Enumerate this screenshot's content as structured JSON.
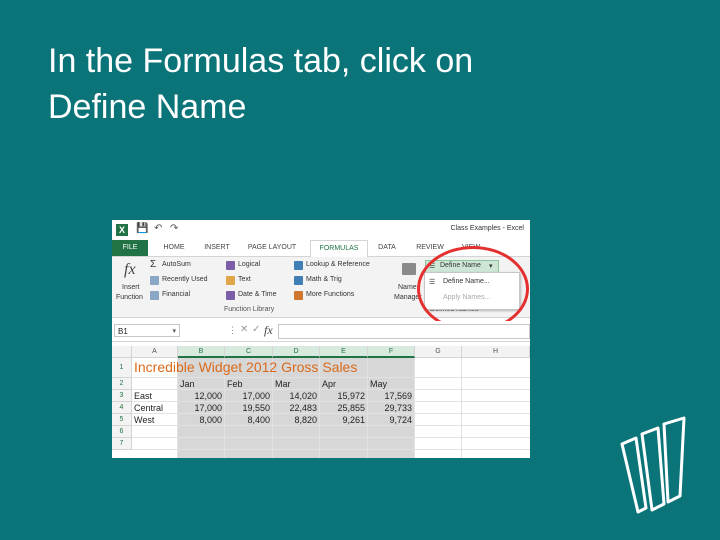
{
  "slide": {
    "title_line1": "In the Formulas tab, click on",
    "title_line2": "Define Name"
  },
  "window": {
    "title": "Class Examples - Excel",
    "app_icon": "X",
    "quick_access": [
      "save-icon",
      "undo-icon",
      "redo-icon"
    ]
  },
  "tabs": [
    "FILE",
    "HOME",
    "INSERT",
    "PAGE LAYOUT",
    "FORMULAS",
    "DATA",
    "REVIEW",
    "VIEW"
  ],
  "active_tab": "FORMULAS",
  "ribbon": {
    "insert_function": {
      "icon": "fx",
      "line1": "Insert",
      "line2": "Function"
    },
    "function_library": {
      "autosum": "AutoSum",
      "recently_used": "Recently Used",
      "financial": "Financial",
      "logical": "Logical",
      "text": "Text",
      "date_time": "Date & Time",
      "lookup": "Lookup & Reference",
      "math": "Math & Trig",
      "more": "More Functions",
      "label": "Function Library"
    },
    "name_manager": {
      "line1": "Name",
      "line2": "Manager"
    },
    "defined_names": {
      "define_name_button": "Define Name",
      "menu_items": [
        "Define Name...",
        "Apply Names..."
      ],
      "label": "Defined Names"
    }
  },
  "formula_bar": {
    "name_box": "B1",
    "fx_icon": "fx"
  },
  "sheet": {
    "columns": [
      "A",
      "B",
      "C",
      "D",
      "E",
      "F",
      "G",
      "H"
    ],
    "rows": [
      "1",
      "2",
      "3",
      "4",
      "5",
      "6",
      "7"
    ],
    "title_cell": "Incredible Widget 2012 Gross Sales",
    "months": [
      "Jan",
      "Feb",
      "Mar",
      "Apr",
      "May"
    ],
    "data": [
      {
        "region": "East",
        "values": [
          "12,000",
          "17,000",
          "14,020",
          "15,972",
          "17,569"
        ]
      },
      {
        "region": "Central",
        "values": [
          "17,000",
          "19,550",
          "22,483",
          "25,855",
          "29,733"
        ]
      },
      {
        "region": "West",
        "values": [
          "8,000",
          "8,400",
          "8,820",
          "9,261",
          "9,724"
        ]
      }
    ]
  },
  "colors": {
    "background": "#0b7479",
    "excel_green": "#217346",
    "highlight_circle": "#e53030",
    "title_cell": "#d96a1b"
  }
}
